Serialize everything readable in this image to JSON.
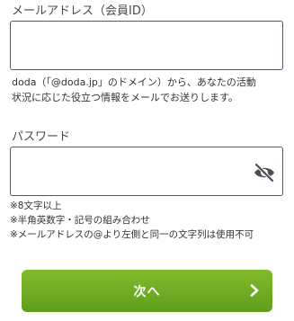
{
  "email": {
    "label": "メールアドレス（会員ID）",
    "value": "",
    "hint_line1": "doda（「@doda.jp」のドメイン）から、あなたの活動",
    "hint_line2": "状況に応じた役立つ情報をメールでお送りします。"
  },
  "password": {
    "label": "パスワード",
    "value": "",
    "toggle_icon": "eye-slash-icon",
    "rules": [
      "※8文字以上",
      "※半角英数字・記号の組み合わせ",
      "※メールアドレスの@より左側と同一の文字列は使用不可"
    ]
  },
  "next_button": {
    "label": "次へ",
    "icon": "chevron-right-icon"
  },
  "colors": {
    "button": "#6eaa23",
    "field_border": "#4f5a6a",
    "icon": "#4a4f55"
  }
}
